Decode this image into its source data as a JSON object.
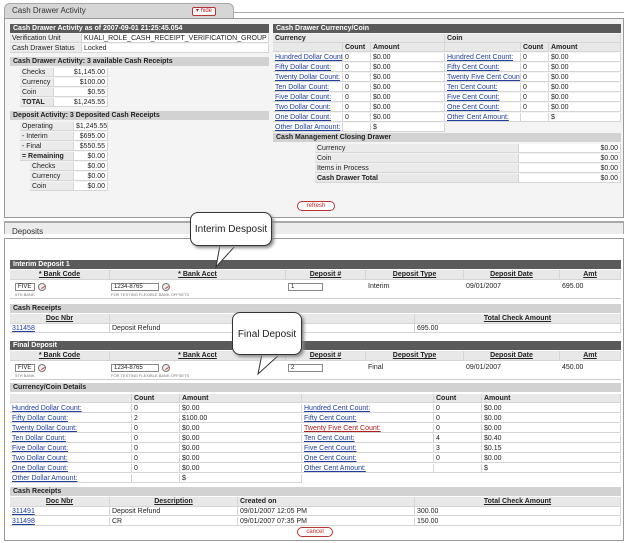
{
  "tab1": {
    "title": "Cash Drawer Activity",
    "hide_label": "▾ hide"
  },
  "tab2": {
    "title": "Deposits"
  },
  "activity": {
    "header": "Cash Drawer Activity as of 2007-09-01 21:25:45.054",
    "rows": [
      {
        "label": "Verification Unit",
        "value": "KUALI_ROLE_CASH_RECEIPT_VERIFICATION_GROUP"
      },
      {
        "label": "Cash Drawer Status",
        "value": "Locked"
      }
    ]
  },
  "cash_receipts": {
    "header": "Cash Drawer Activity: 3 available Cash Receipts",
    "rows": [
      {
        "label": "Checks",
        "value": "$1,145.00"
      },
      {
        "label": "Currency",
        "value": "$100.00"
      },
      {
        "label": "Coin",
        "value": "$0.55"
      },
      {
        "label": "TOTAL",
        "value": "$1,245.55"
      }
    ]
  },
  "deposit_activity": {
    "header": "Deposit Activity: 3 Deposited Cash Receipts",
    "rows": [
      {
        "label": "Operating",
        "value": "$1,245.55"
      },
      {
        "label": "- Interim",
        "value": "$695.00"
      },
      {
        "label": "- Final",
        "value": "$550.55"
      },
      {
        "label": "= Remaining",
        "value": "$0.00"
      },
      {
        "label": "Checks",
        "value": "$0.00"
      },
      {
        "label": "Currency",
        "value": "$0.00"
      },
      {
        "label": "Coin",
        "value": "$0.00"
      }
    ]
  },
  "currency_coin": {
    "header": "Cash Drawer Currency/Coin",
    "currency_label": "Currency",
    "coin_label": "Coin",
    "count_label": "Count",
    "amount_label": "Amount",
    "currency_rows": [
      {
        "label": "Hundred Dollar Count:",
        "count": "0",
        "amount": "$0.00"
      },
      {
        "label": "Fifty Dollar Count:",
        "count": "0",
        "amount": "$0.00"
      },
      {
        "label": "Twenty Dollar Count:",
        "count": "0",
        "amount": "$0.00"
      },
      {
        "label": "Ten Dollar Count:",
        "count": "0",
        "amount": "$0.00"
      },
      {
        "label": "Five Dollar Count:",
        "count": "0",
        "amount": "$0.00"
      },
      {
        "label": "Two Dollar Count:",
        "count": "0",
        "amount": "$0.00"
      },
      {
        "label": "One Dollar Count:",
        "count": "0",
        "amount": "$0.00"
      },
      {
        "label": "Other Dollar Amount:",
        "count": "",
        "amount": "$"
      }
    ],
    "coin_rows": [
      {
        "label": "Hundred Cent Count:",
        "count": "0",
        "amount": "$0.00"
      },
      {
        "label": "Fifty Cent Count:",
        "count": "0",
        "amount": "$0.00"
      },
      {
        "label": "Twenty Five Cent Count:",
        "count": "0",
        "amount": "$0.00"
      },
      {
        "label": "Ten Cent Count:",
        "count": "0",
        "amount": "$0.00"
      },
      {
        "label": "Five Cent Count:",
        "count": "0",
        "amount": "$0.00"
      },
      {
        "label": "One Cent Count:",
        "count": "0",
        "amount": "$0.00"
      },
      {
        "label": "Other Cent Amount:",
        "count": "",
        "amount": "$"
      }
    ]
  },
  "closing": {
    "header": "Cash Management Closing Drawer",
    "rows": [
      {
        "label": "Currency",
        "value": "$0.00"
      },
      {
        "label": "Coin",
        "value": "$0.00"
      },
      {
        "label": "Items in Process",
        "value": "$0.00"
      },
      {
        "label": "Cash Drawer Total",
        "value": "$0.00"
      }
    ]
  },
  "refresh_label": "refresh",
  "cancel_label": "cancel",
  "callouts": {
    "interim": "Interim Desposit",
    "final": "Final Deposit"
  },
  "columns": {
    "bank_code": "* Bank Code",
    "bank_acct": "* Bank Acct",
    "deposit_no": "Deposit #",
    "deposit_type": "Deposit Type",
    "deposit_date": "Deposit Date",
    "amt": "Amt",
    "doc_nbr": "Doc Nbr",
    "description": "Description",
    "total_check": "Total Check Amount",
    "created_on": "Created on",
    "count": "Count",
    "amount": "Amount"
  },
  "interim": {
    "header": "Interim Deposit 1",
    "bank_code": "FIVE",
    "bank_code_note": "5TH BANK",
    "bank_acct": "1234-8765",
    "bank_acct_note": "FOR TESTING FLEXIBLE BANK OFFSETS",
    "deposit_no": "1",
    "deposit_type": "Interim",
    "deposit_date": "09/01/2007",
    "amt": "695.00",
    "receipts_header": "Cash Receipts",
    "receipts": [
      {
        "doc": "311458",
        "desc": "Deposit Refund",
        "total": "695.00"
      }
    ]
  },
  "final": {
    "header": "Final Deposit",
    "bank_code": "FIVE",
    "bank_code_note": "5TH BANK",
    "bank_acct": "1234-8765",
    "bank_acct_note": "FOR TESTING FLEXIBLE BANK OFFSETS",
    "deposit_no": "2",
    "deposit_type": "Final",
    "deposit_date": "09/01/2007",
    "amt": "450.00",
    "cc_header": "Currency/Coin Details",
    "currency_rows": [
      {
        "label": "Hundred Dollar Count:",
        "count": "0",
        "amount": "$0.00"
      },
      {
        "label": "Fifty Dollar Count:",
        "count": "2",
        "amount": "$100.00"
      },
      {
        "label": "Twenty Dollar Count:",
        "count": "0",
        "amount": "$0.00"
      },
      {
        "label": "Ten Dollar Count:",
        "count": "0",
        "amount": "$0.00"
      },
      {
        "label": "Five Dollar Count:",
        "count": "0",
        "amount": "$0.00"
      },
      {
        "label": "Two Dollar Count:",
        "count": "0",
        "amount": "$0.00"
      },
      {
        "label": "One Dollar Count:",
        "count": "0",
        "amount": "$0.00"
      },
      {
        "label": "Other Dollar Amount:",
        "count": "",
        "amount": "$"
      }
    ],
    "coin_rows": [
      {
        "label": "Hundred Cent Count:",
        "count": "0",
        "amount": "$0.00"
      },
      {
        "label": "Fifty Cent Count:",
        "count": "0",
        "amount": "$0.00"
      },
      {
        "label": "Twenty Five Cent Count:",
        "count": "0",
        "amount": "$0.00"
      },
      {
        "label": "Ten Cent Count:",
        "count": "4",
        "amount": "$0.40"
      },
      {
        "label": "Five Cent Count:",
        "count": "3",
        "amount": "$0.15"
      },
      {
        "label": "One Cent Count:",
        "count": "0",
        "amount": "$0.00"
      },
      {
        "label": "Other Cent Amount:",
        "count": "",
        "amount": "$"
      }
    ],
    "receipts_header": "Cash Receipts",
    "receipts": [
      {
        "doc": "311491",
        "desc": "Deposit Refund",
        "created": "09/01/2007 12:05 PM",
        "total": "300.00"
      },
      {
        "doc": "311498",
        "desc": "CR",
        "created": "09/01/2007 07:35 PM",
        "total": "150.00"
      }
    ]
  }
}
